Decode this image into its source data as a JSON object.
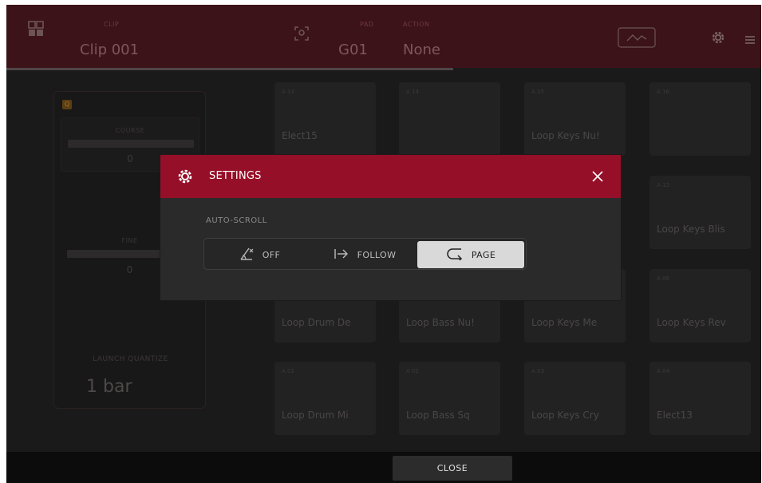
{
  "header": {
    "grid_icon": "grid-icon",
    "clip_small_label": "CLIP",
    "clip_name": "Clip 001",
    "focus_icon": "focus-pad-icon",
    "pad_small_label": "PAD",
    "pad_value": "G01",
    "follow_small_label": "ACTION",
    "follow_value": "None",
    "automation_icon": "automation-icon",
    "settings_icon": "gear-icon",
    "menu_icon": "menu-icon"
  },
  "left_panel": {
    "badge": "Q",
    "course_label": "COURSE",
    "course_value": "0",
    "fine_label": "FINE",
    "fine_value": "0",
    "launch_quantize_label": "LAUNCH QUANTIZE",
    "launch_quantize_value": "1 bar"
  },
  "pads": [
    {
      "id": "A 13",
      "name": "Elect15"
    },
    {
      "id": "A 14",
      "name": ""
    },
    {
      "id": "A 15",
      "name": "Loop Keys Nu!"
    },
    {
      "id": "A 16",
      "name": ""
    },
    {
      "id": "A 12",
      "name": "Loop Keys Blis"
    },
    {
      "id": "A 08",
      "name": "Loop Keys Rev"
    },
    {
      "id": "",
      "name": "Loop Drum De"
    },
    {
      "id": "",
      "name": "Loop Bass Nu!"
    },
    {
      "id": "",
      "name": "Loop Keys Me"
    },
    {
      "id": "A 01",
      "name": "Loop Drum Mi"
    },
    {
      "id": "A 02",
      "name": "Loop Bass Sq"
    },
    {
      "id": "A 03",
      "name": "Loop Keys Cry"
    },
    {
      "id": "A 04",
      "name": "Elect13"
    }
  ],
  "dialog": {
    "title": "SETTINGS",
    "gear_icon": "gear-icon",
    "close_icon": "close-icon",
    "autoscroll_label": "AUTO-SCROLL",
    "options": [
      {
        "label": "OFF",
        "icon": "autoscroll-off-icon",
        "selected": false
      },
      {
        "label": "FOLLOW",
        "icon": "arrow-follow-icon",
        "selected": false
      },
      {
        "label": "PAGE",
        "icon": "page-wrap-icon",
        "selected": true
      }
    ]
  },
  "footer": {
    "close_label": "CLOSE"
  },
  "colors": {
    "header_bg": "#3c1318",
    "dialog_header": "#960f28",
    "background": "#1a1a1a",
    "selected_option": "#d9d9d9"
  }
}
